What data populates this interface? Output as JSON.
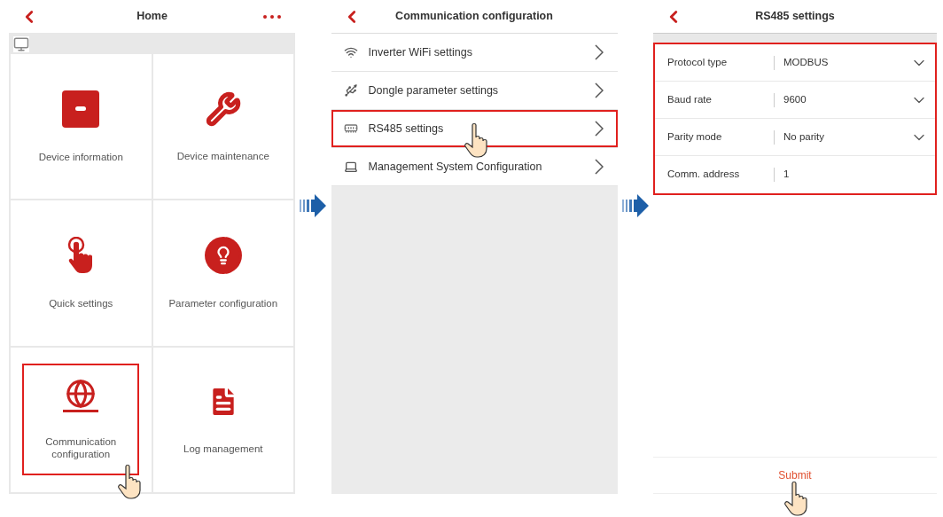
{
  "home": {
    "title": "Home",
    "tiles": [
      {
        "label": "Device information",
        "highlighted": false
      },
      {
        "label": "Device maintenance",
        "highlighted": false
      },
      {
        "label": "Quick settings",
        "highlighted": false
      },
      {
        "label": "Parameter configuration",
        "highlighted": false
      },
      {
        "label": "Communication configuration",
        "highlighted": true
      },
      {
        "label": "Log management",
        "highlighted": false
      }
    ]
  },
  "communication": {
    "title": "Communication configuration",
    "items": [
      {
        "label": "Inverter WiFi settings",
        "highlighted": false
      },
      {
        "label": "Dongle parameter settings",
        "highlighted": false
      },
      {
        "label": "RS485 settings",
        "highlighted": true
      },
      {
        "label": "Management System Configuration",
        "highlighted": false
      }
    ]
  },
  "rs485": {
    "title": "RS485 settings",
    "highlighted": true,
    "fields": [
      {
        "kind": "dropdown",
        "label": "Protocol type",
        "value": "MODBUS"
      },
      {
        "kind": "dropdown",
        "label": "Baud rate",
        "value": "9600"
      },
      {
        "kind": "dropdown",
        "label": "Parity mode",
        "value": "No parity"
      },
      {
        "kind": "input",
        "label": "Comm. address",
        "value": "1"
      }
    ],
    "submit": "Submit"
  }
}
